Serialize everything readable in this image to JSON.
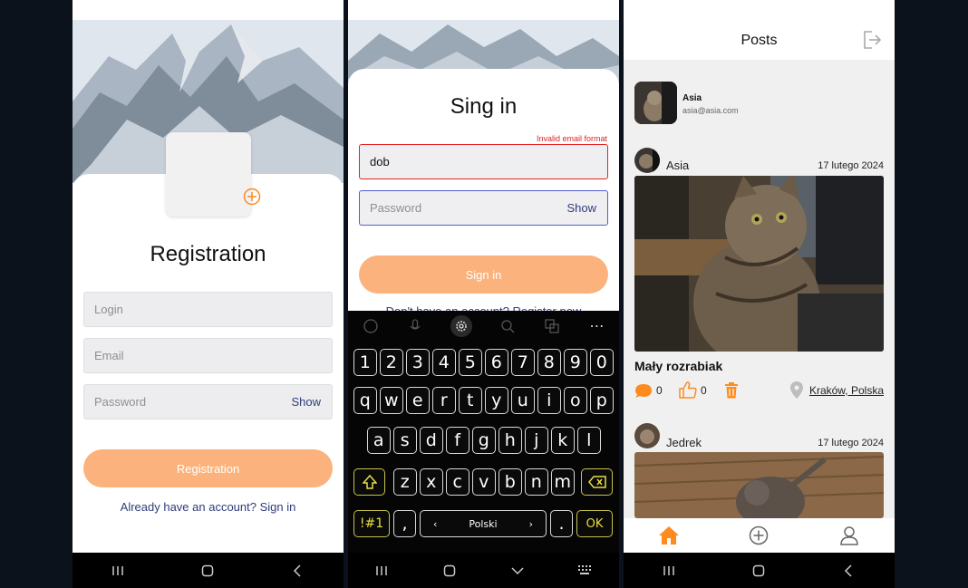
{
  "registration": {
    "title": "Registration",
    "login_placeholder": "Login",
    "email_placeholder": "Email",
    "password_placeholder": "Password",
    "show_label": "Show",
    "submit_label": "Registration",
    "signin_link": "Already have an account? Sign in"
  },
  "signin": {
    "title": "Sing in",
    "error": "Invalid email format",
    "email_value": "dob",
    "password_placeholder": "Password",
    "show_label": "Show",
    "submit_label": "Sign in",
    "register_link": "Don't have an account? Register now"
  },
  "keyboard": {
    "row_numbers": [
      "1",
      "2",
      "3",
      "4",
      "5",
      "6",
      "7",
      "8",
      "9",
      "0"
    ],
    "row_1": [
      "q",
      "w",
      "e",
      "r",
      "t",
      "y",
      "u",
      "i",
      "o",
      "p"
    ],
    "row_2": [
      "a",
      "s",
      "d",
      "f",
      "g",
      "h",
      "j",
      "k",
      "l"
    ],
    "row_3": [
      "z",
      "x",
      "c",
      "v",
      "b",
      "n",
      "m"
    ],
    "symbols_label": "!#1",
    "comma_label": ",",
    "language_label": "Polski",
    "period_label": ".",
    "ok_label": "OK"
  },
  "posts": {
    "title": "Posts",
    "user": {
      "name": "Asia",
      "email": "asia@asia.com"
    },
    "items": [
      {
        "author": "Asia",
        "date": "17 lutego 2024",
        "caption": "Mały rozrabiak",
        "comments": "0",
        "likes": "0",
        "location": "Kraków, Polska"
      },
      {
        "author": "Jedrek",
        "date": "17 lutego 2024"
      }
    ]
  },
  "colors": {
    "accent": "#ff8a1e",
    "button": "#fbb27c",
    "error": "#e02424",
    "focus": "#4f5fd0"
  }
}
